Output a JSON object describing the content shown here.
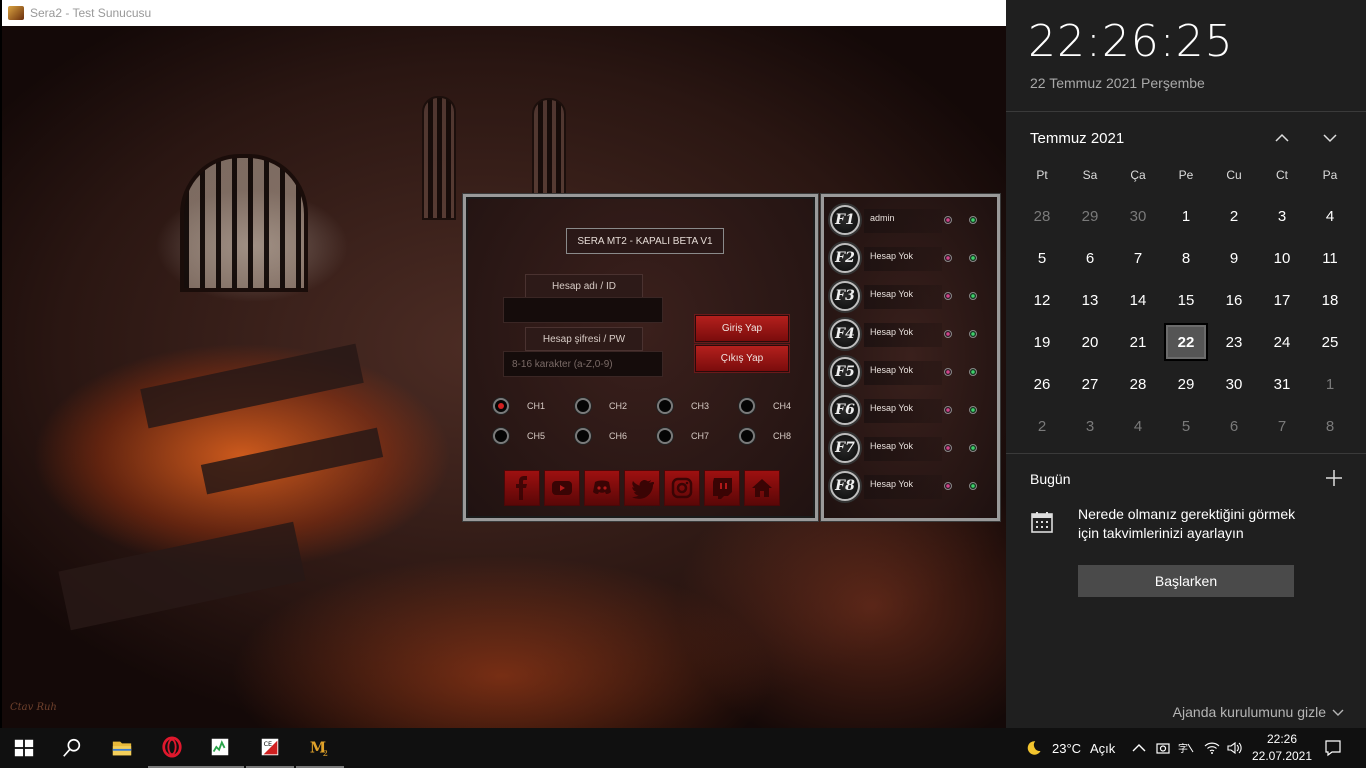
{
  "window": {
    "title": "Sera2 - Test Sunucusu"
  },
  "login": {
    "server_title": "SERA MT2 - KAPALI BETA V1",
    "username_label": "Hesap adı / ID",
    "username_value": "",
    "password_label": "Hesap şifresi / PW",
    "password_placeholder": "8-16 karakter (a-Z,0-9)",
    "login_button": "Giriş Yap",
    "exit_button": "Çıkış Yap",
    "channels": [
      {
        "label": "CH1",
        "selected": true
      },
      {
        "label": "CH2",
        "selected": false
      },
      {
        "label": "CH3",
        "selected": false
      },
      {
        "label": "CH4",
        "selected": false
      },
      {
        "label": "CH5",
        "selected": false
      },
      {
        "label": "CH6",
        "selected": false
      },
      {
        "label": "CH7",
        "selected": false
      },
      {
        "label": "CH8",
        "selected": false
      }
    ],
    "social_icons": [
      "facebook-icon",
      "youtube-icon",
      "discord-icon",
      "twitter-icon",
      "instagram-icon",
      "twitch-icon",
      "home-icon"
    ]
  },
  "accounts": [
    {
      "key": "F1",
      "name": "admin"
    },
    {
      "key": "F2",
      "name": "Hesap Yok"
    },
    {
      "key": "F3",
      "name": "Hesap Yok"
    },
    {
      "key": "F4",
      "name": "Hesap Yok"
    },
    {
      "key": "F5",
      "name": "Hesap Yok"
    },
    {
      "key": "F6",
      "name": "Hesap Yok"
    },
    {
      "key": "F7",
      "name": "Hesap Yok"
    },
    {
      "key": "F8",
      "name": "Hesap Yok"
    }
  ],
  "calendar": {
    "time": "22:26:25",
    "date": "22 Temmuz 2021 Perşembe",
    "month": "Temmuz 2021",
    "weekdays": [
      "Pt",
      "Sa",
      "Ça",
      "Pe",
      "Cu",
      "Ct",
      "Pa"
    ],
    "days": [
      {
        "n": "28",
        "other": true
      },
      {
        "n": "29",
        "other": true
      },
      {
        "n": "30",
        "other": true
      },
      {
        "n": "1"
      },
      {
        "n": "2"
      },
      {
        "n": "3"
      },
      {
        "n": "4"
      },
      {
        "n": "5"
      },
      {
        "n": "6"
      },
      {
        "n": "7"
      },
      {
        "n": "8"
      },
      {
        "n": "9"
      },
      {
        "n": "10"
      },
      {
        "n": "11"
      },
      {
        "n": "12"
      },
      {
        "n": "13"
      },
      {
        "n": "14"
      },
      {
        "n": "15"
      },
      {
        "n": "16"
      },
      {
        "n": "17"
      },
      {
        "n": "18"
      },
      {
        "n": "19"
      },
      {
        "n": "20"
      },
      {
        "n": "21"
      },
      {
        "n": "22",
        "today": true
      },
      {
        "n": "23"
      },
      {
        "n": "24"
      },
      {
        "n": "25"
      },
      {
        "n": "26"
      },
      {
        "n": "27"
      },
      {
        "n": "28"
      },
      {
        "n": "29"
      },
      {
        "n": "30"
      },
      {
        "n": "31"
      },
      {
        "n": "1",
        "other": true
      },
      {
        "n": "2",
        "other": true
      },
      {
        "n": "3",
        "other": true
      },
      {
        "n": "4",
        "other": true
      },
      {
        "n": "5",
        "other": true
      },
      {
        "n": "6",
        "other": true
      },
      {
        "n": "7",
        "other": true
      },
      {
        "n": "8",
        "other": true
      }
    ],
    "today_label": "Bugün",
    "agenda_message": "Nerede olmanız gerektiğini görmek için takvimlerinizi ayarlayın",
    "start_button": "Başlarken",
    "hide_agenda": "Ajanda kurulumunu gizle"
  },
  "taskbar": {
    "weather_temp": "23°C",
    "weather_desc": "Açık",
    "time": "22:26",
    "date": "22.07.2021",
    "accent": "#7a7a7a"
  }
}
